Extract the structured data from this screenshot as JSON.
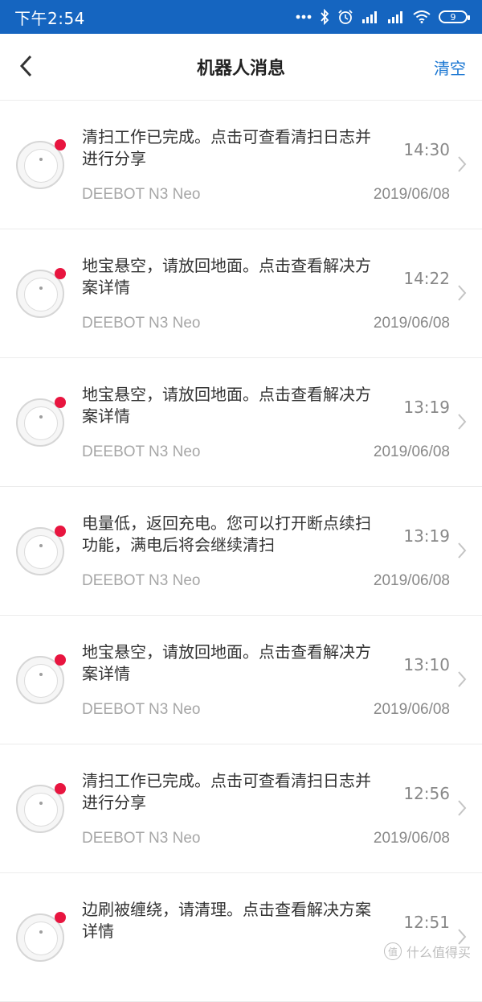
{
  "status_bar": {
    "time": "下午2:54",
    "battery": "9",
    "icons": [
      "dots-icon",
      "bluetooth-icon",
      "alarm-icon",
      "signal-icon",
      "signal-icon",
      "wifi-icon",
      "battery-icon"
    ]
  },
  "header": {
    "title": "机器人消息",
    "clear_label": "清空"
  },
  "messages": [
    {
      "text": "清扫工作已完成。点击可查看清扫日志并进行分享",
      "time": "14:30",
      "device": "DEEBOT N3 Neo",
      "date": "2019/06/08"
    },
    {
      "text": "地宝悬空，请放回地面。点击查看解决方案详情",
      "time": "14:22",
      "device": "DEEBOT N3 Neo",
      "date": "2019/06/08"
    },
    {
      "text": "地宝悬空，请放回地面。点击查看解决方案详情",
      "time": "13:19",
      "device": "DEEBOT N3 Neo",
      "date": "2019/06/08"
    },
    {
      "text": "电量低，返回充电。您可以打开断点续扫功能，满电后将会继续清扫",
      "time": "13:19",
      "device": "DEEBOT N3 Neo",
      "date": "2019/06/08"
    },
    {
      "text": "地宝悬空，请放回地面。点击查看解决方案详情",
      "time": "13:10",
      "device": "DEEBOT N3 Neo",
      "date": "2019/06/08"
    },
    {
      "text": "清扫工作已完成。点击可查看清扫日志并进行分享",
      "time": "12:56",
      "device": "DEEBOT N3 Neo",
      "date": "2019/06/08"
    },
    {
      "text": "边刷被缠绕，请清理。点击查看解决方案详情",
      "time": "12:51",
      "device": "",
      "date": ""
    }
  ],
  "watermark": {
    "badge": "值",
    "text": "什么值得买"
  }
}
